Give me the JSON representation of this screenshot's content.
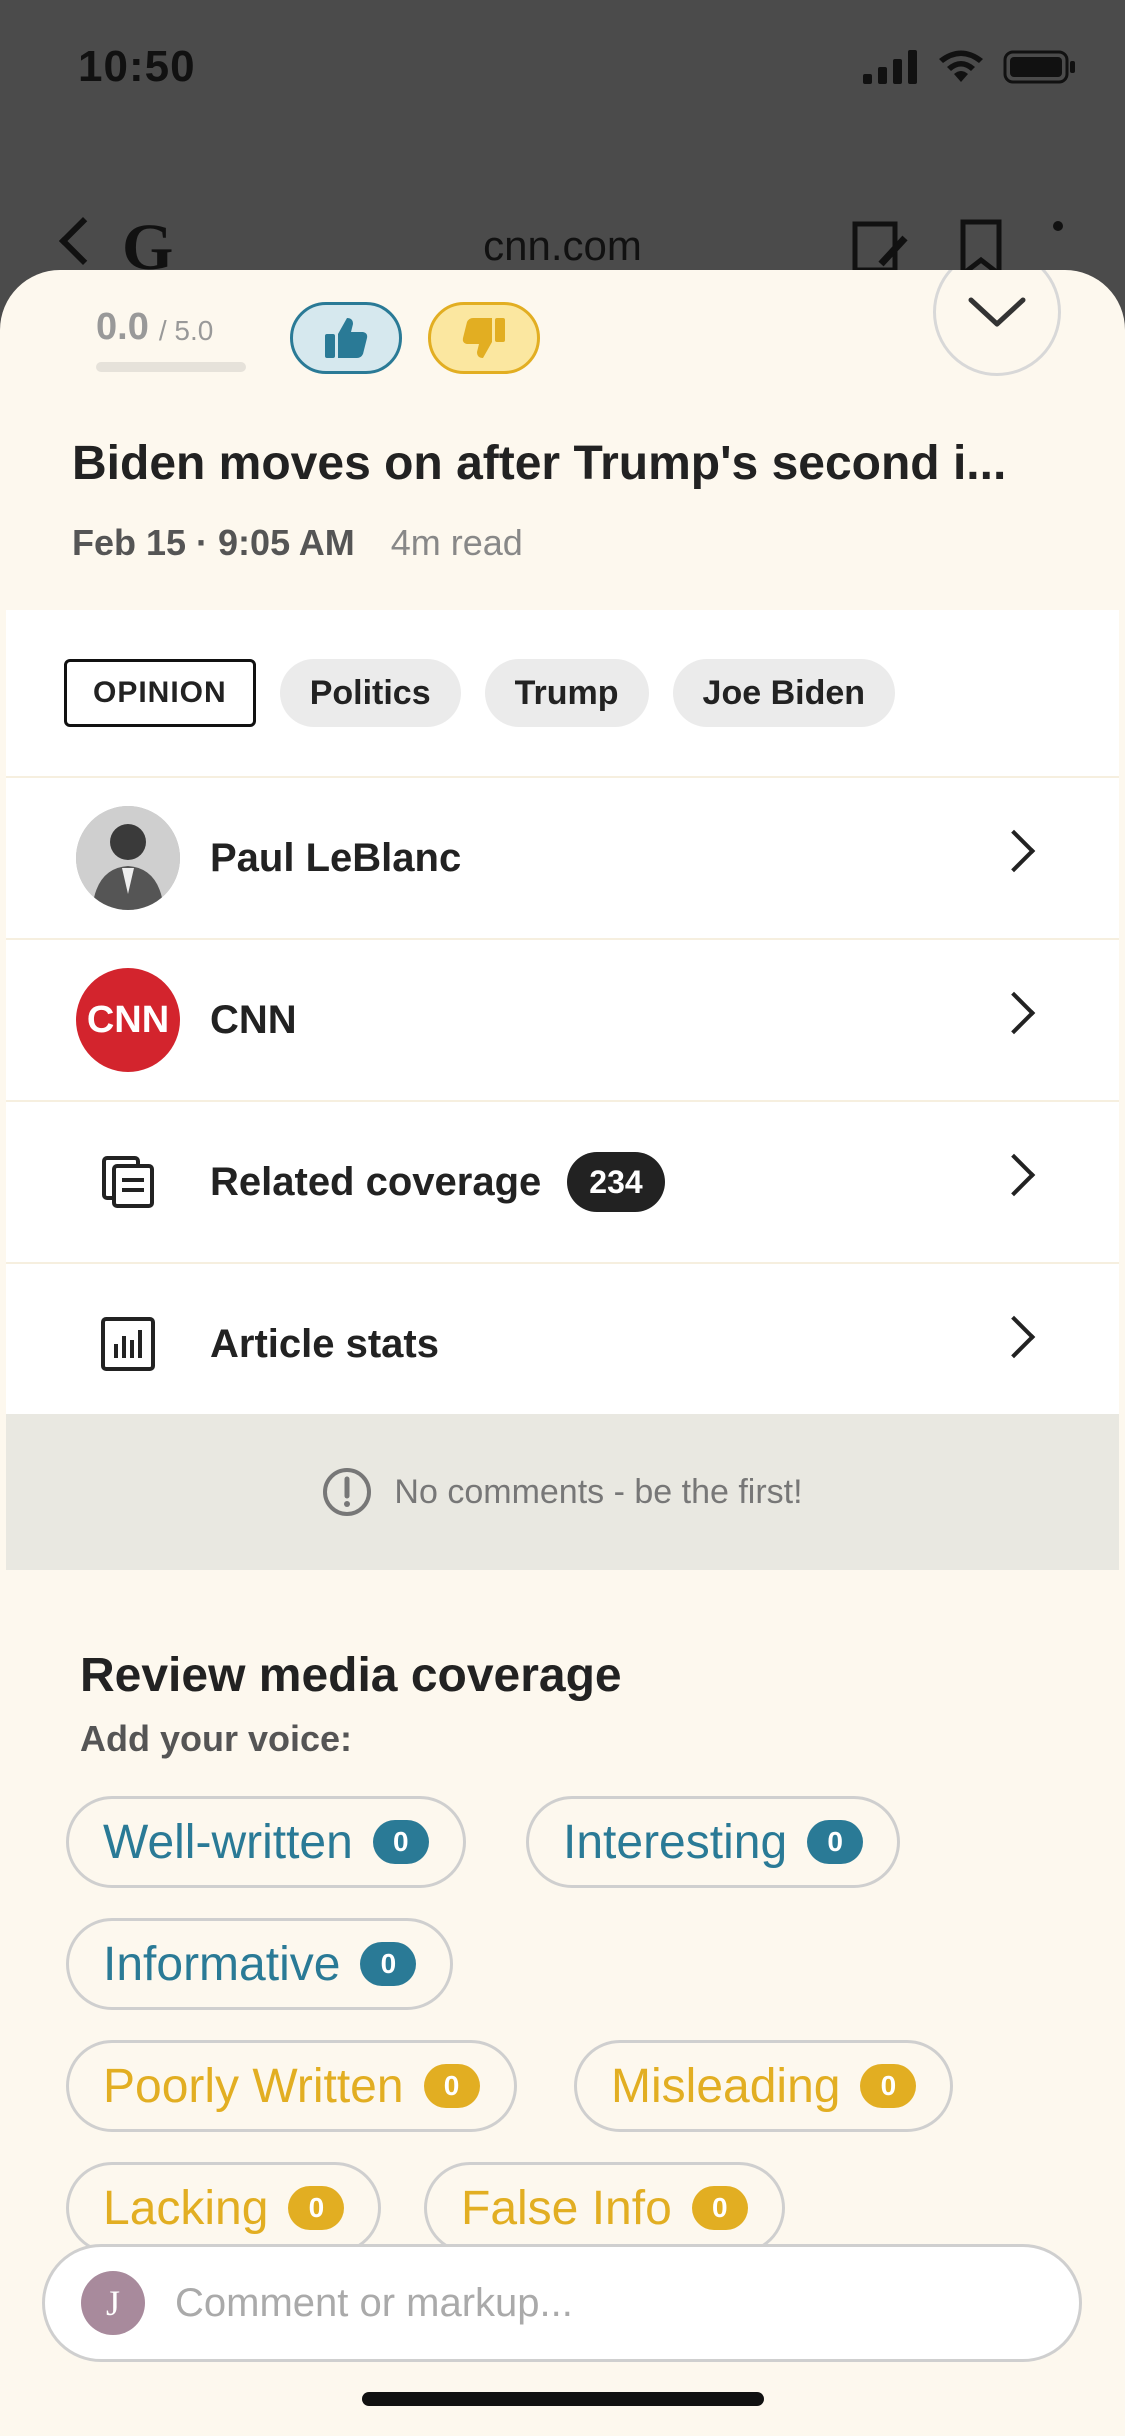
{
  "status_bar": {
    "time": "10:50"
  },
  "background_nav": {
    "logo": "G",
    "domain": "cnn.com"
  },
  "rating": {
    "score": "0.0",
    "max": "/ 5.0"
  },
  "article": {
    "headline": "Biden moves on after Trump's second i...",
    "date": "Feb 15 · 9:05 AM",
    "read_time": "4m read"
  },
  "tags": [
    "OPINION",
    "Politics",
    "Trump",
    "Joe Biden"
  ],
  "rows": {
    "author": "Paul LeBlanc",
    "source": "CNN",
    "source_logo": "CNN",
    "related": "Related coverage",
    "related_count": "234",
    "stats": "Article stats"
  },
  "comments": {
    "empty_text": "No comments - be the first!"
  },
  "review": {
    "title": "Review media coverage",
    "subtitle": "Add your voice:",
    "positive": [
      {
        "label": "Well-written",
        "count": "0"
      },
      {
        "label": "Interesting",
        "count": "0"
      },
      {
        "label": "Informative",
        "count": "0"
      }
    ],
    "negative": [
      {
        "label": "Poorly Written",
        "count": "0"
      },
      {
        "label": "Misleading",
        "count": "0"
      },
      {
        "label": "Lacking",
        "count": "0"
      },
      {
        "label": "False Info",
        "count": "0"
      }
    ]
  },
  "composer": {
    "avatar_initial": "J",
    "placeholder": "Comment or markup..."
  },
  "colors": {
    "positive": "#2a7a96",
    "negative": "#e2ae22",
    "sheet": "#fdf8ee"
  }
}
